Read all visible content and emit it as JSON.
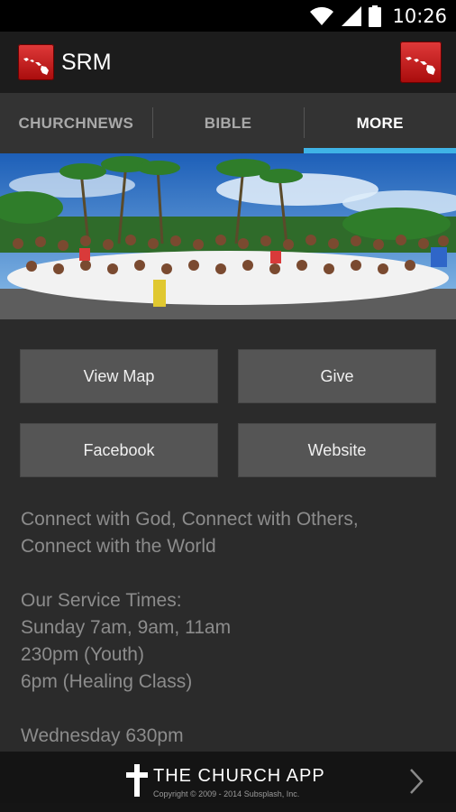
{
  "status": {
    "time": "10:26",
    "wifi_icon": "wifi-icon",
    "signal_icon": "signal-icon",
    "battery_icon": "battery-icon"
  },
  "app": {
    "title": "SRM",
    "accent": "#3fb3e6",
    "brand": "#c01717"
  },
  "tabs": [
    {
      "label": "CHURCHNEWS",
      "active": false
    },
    {
      "label": "BIBLE",
      "active": false
    },
    {
      "label": "MORE",
      "active": true
    }
  ],
  "buttons": {
    "view_map": "View Map",
    "give": "Give",
    "facebook": "Facebook",
    "website": "Website"
  },
  "description": {
    "tagline1": "Connect with God, Connect with Others,",
    "tagline2": "Connect with the World",
    "service_heading": "Our Service Times:",
    "sunday": "Sunday 7am, 9am, 11am",
    "youth": "230pm (Youth)",
    "healing": "6pm (Healing Class)",
    "wednesday": "Wednesday 630pm"
  },
  "footer": {
    "brand": "THE CHURCH APP",
    "copyright": "Copyright © 2009 - 2014 Subsplash, Inc."
  }
}
